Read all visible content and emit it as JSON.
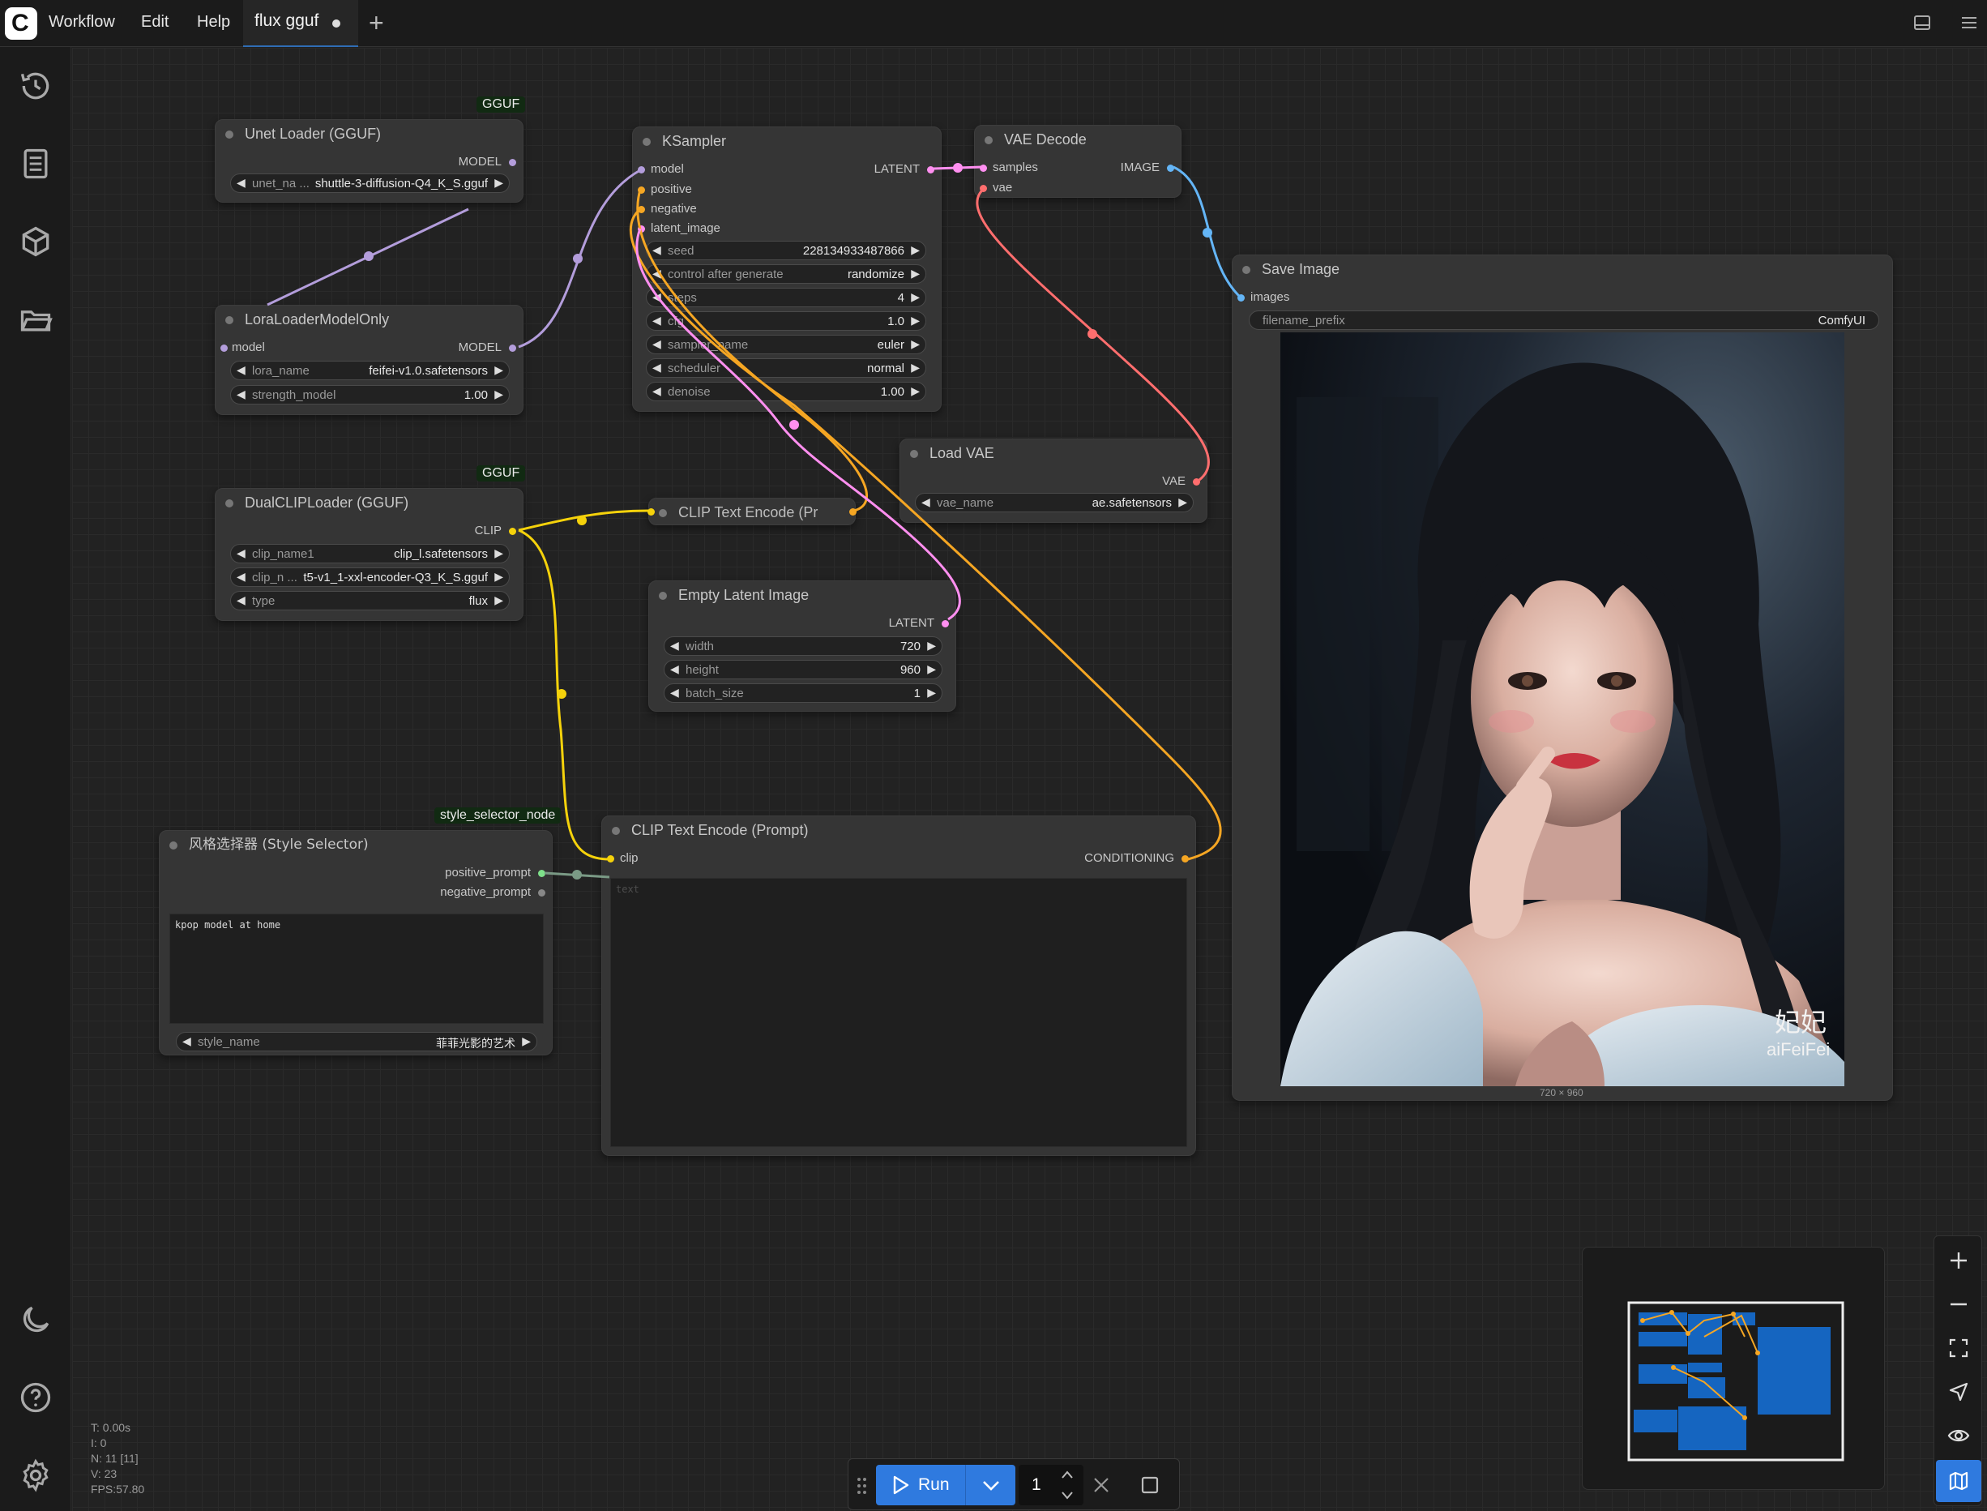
{
  "app": {
    "menu": [
      "Workflow",
      "Edit",
      "Help"
    ],
    "tab_label": "flux gguf"
  },
  "nodes": {
    "unet": {
      "badge": "GGUF",
      "title": "Unet Loader (GGUF)",
      "output": "MODEL",
      "widgets": [
        {
          "name": "unet_na ...",
          "value": "shuttle-3-diffusion-Q4_K_S.gguf"
        }
      ]
    },
    "lora": {
      "title": "LoraLoaderModelOnly",
      "input": "model",
      "output": "MODEL",
      "widgets": [
        {
          "name": "lora_name",
          "value": "feifei-v1.0.safetensors"
        },
        {
          "name": "strength_model",
          "value": "1.00"
        }
      ]
    },
    "dualclip": {
      "badge": "GGUF",
      "title": "DualCLIPLoader (GGUF)",
      "output": "CLIP",
      "widgets": [
        {
          "name": "clip_name1",
          "value": "clip_l.safetensors"
        },
        {
          "name": "clip_n ...",
          "value": "t5-v1_1-xxl-encoder-Q3_K_S.gguf"
        },
        {
          "name": "type",
          "value": "flux"
        }
      ]
    },
    "ksampler": {
      "title": "KSampler",
      "inputs": [
        "model",
        "positive",
        "negative",
        "latent_image"
      ],
      "output": "LATENT",
      "widgets": [
        {
          "name": "seed",
          "value": "228134933487866"
        },
        {
          "name": "control after generate",
          "value": "randomize"
        },
        {
          "name": "steps",
          "value": "4"
        },
        {
          "name": "cfg",
          "value": "1.0"
        },
        {
          "name": "sampler_name",
          "value": "euler"
        },
        {
          "name": "scheduler",
          "value": "normal"
        },
        {
          "name": "denoise",
          "value": "1.00"
        }
      ]
    },
    "vaedecode": {
      "title": "VAE Decode",
      "inputs": [
        "samples",
        "vae"
      ],
      "output": "IMAGE"
    },
    "loadvae": {
      "title": "Load VAE",
      "output": "VAE",
      "widgets": [
        {
          "name": "vae_name",
          "value": "ae.safetensors"
        }
      ]
    },
    "clip_collapsed": {
      "title": "CLIP Text Encode (Pr"
    },
    "latent": {
      "title": "Empty Latent Image",
      "output": "LATENT",
      "widgets": [
        {
          "name": "width",
          "value": "720"
        },
        {
          "name": "height",
          "value": "960"
        },
        {
          "name": "batch_size",
          "value": "1"
        }
      ]
    },
    "style": {
      "badge": "style_selector_node",
      "title": "风格选择器 (Style Selector)",
      "outputs": [
        "positive_prompt",
        "negative_prompt"
      ],
      "text": "kpop model at home",
      "widgets": [
        {
          "name": "style_name",
          "value": "菲菲光影的艺术"
        }
      ]
    },
    "clipprompt": {
      "title": "CLIP Text Encode (Prompt)",
      "input": "clip",
      "output": "CONDITIONING",
      "placeholder": "text"
    },
    "save": {
      "title": "Save Image",
      "input": "images",
      "widgets": [
        {
          "name": "filename_prefix",
          "value": "ComfyUI"
        }
      ],
      "watermark_cn": "妃妃",
      "watermark_en": "aiFeiFei",
      "dims": "720 × 960"
    }
  },
  "stats": [
    "T: 0.00s",
    "I: 0",
    "N: 11 [11]",
    "V: 23",
    "FPS:57.80"
  ],
  "runbar": {
    "run_label": "Run",
    "count": "1"
  },
  "colors": {
    "model_wire": "#b39ddb",
    "clip_wire": "#f5d20b",
    "conditioning_wire": "#f5a623",
    "latent_wire": "#ff8ff0",
    "vae_wire": "#ff6e6e",
    "image_wire": "#64b5f6",
    "accent": "#2f7adf",
    "node_bg": "#353535",
    "canvas_bg": "#222222"
  },
  "icons": [
    "comfy-logo-icon",
    "history-icon",
    "queue-icon",
    "model-library-icon",
    "workflows-folder-icon",
    "theme-moon-icon",
    "help-icon",
    "settings-gear-icon",
    "panel-toggle-icon",
    "hamburger-menu-icon",
    "zoom-in-icon",
    "zoom-out-icon",
    "fit-view-icon",
    "select-pointer-icon",
    "visibility-eye-icon",
    "minimap-icon",
    "play-icon",
    "chevron-down-icon",
    "close-x-icon",
    "stop-square-icon",
    "drag-handle-icon"
  ]
}
